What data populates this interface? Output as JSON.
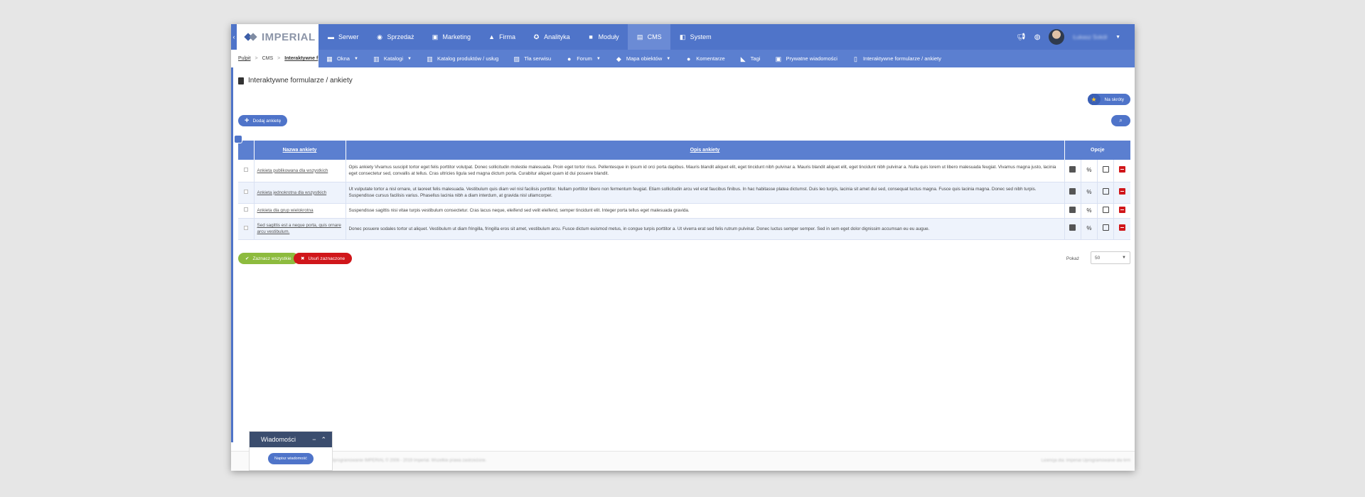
{
  "brand": {
    "name": "IMPERIAL"
  },
  "topnav": {
    "items": [
      {
        "label": "Serwer",
        "icon": "server-icon"
      },
      {
        "label": "Sprzedaż",
        "icon": "sales-icon"
      },
      {
        "label": "Marketing",
        "icon": "marketing-icon"
      },
      {
        "label": "Firma",
        "icon": "company-icon"
      },
      {
        "label": "Analityka",
        "icon": "analytics-icon"
      },
      {
        "label": "Moduły",
        "icon": "modules-icon"
      },
      {
        "label": "CMS",
        "icon": "cms-icon",
        "active": true
      },
      {
        "label": "System",
        "icon": "system-icon"
      }
    ],
    "user": {
      "name": "Łukasz Sokół"
    }
  },
  "breadcrumb": {
    "items": [
      "Pulpit",
      "CMS",
      "Interaktywne f"
    ]
  },
  "subnav": {
    "items": [
      {
        "label": "Okna",
        "dropdown": true
      },
      {
        "label": "Katalogi",
        "dropdown": true
      },
      {
        "label": "Katalog produktów / usług",
        "dropdown": false
      },
      {
        "label": "Tła serwisu",
        "dropdown": false
      },
      {
        "label": "Forum",
        "dropdown": true
      },
      {
        "label": "Mapa obiektów",
        "dropdown": true
      },
      {
        "label": "Komentarze",
        "dropdown": false
      },
      {
        "label": "Tagi",
        "dropdown": false
      },
      {
        "label": "Prywatne wiadomości",
        "dropdown": false
      },
      {
        "label": "Interaktywne formularze / ankiety",
        "dropdown": false
      }
    ]
  },
  "page": {
    "title": "Interaktywne formularze / ankiety"
  },
  "actions": {
    "favorite_label": "Na skróty",
    "add_label": "Dodaj ankietę",
    "check_all_label": "Zaznacz wszystkie",
    "delete_selected_label": "Usuń zaznaczone"
  },
  "table": {
    "headers": {
      "name": "Nazwa ankiety",
      "description": "Opis ankiety",
      "options": "Opcje"
    },
    "rows": [
      {
        "name": "Ankieta publikowana dla wszystkich",
        "description": "Opis ankiety Vivamus suscipit tortor eget felis porttitor volutpat. Donec sollicitudin molestie malesuada. Proin eget tortor risus. Pellentesque in ipsum id orci porta dapibus. Mauris blandit aliquet elit, eget tincidunt nibh pulvinar a. Mauris blandit aliquet elit, eget tincidunt nibh pulvinar a. Nulla quis lorem ut libero malesuada feugiat. Vivamus magna justo, lacinia eget consectetur sed, convallis at tellus. Cras ultricies ligula sed magna dictum porta. Curabitur aliquet quam id dui posuere blandit."
      },
      {
        "name": "Ankieta jednokrotna dla wszystkich",
        "description": "Ut vulputate tortor a nisl ornare, ut laoreet felis malesuada. Vestibulum quis diam vel nisl facilisis porttitor. Nullam porttitor libero non fermentum feugiat. Etiam sollicitudin arcu vel erat faucibus finibus. In hac habitasse platea dictumst. Duis leo turpis, lacinia sit amet dui sed, consequat luctus magna. Fusce quis lacinia magna. Donec sed nibh turpis. Suspendisse cursus facilisis varius. Phasellus lacinia nibh a diam interdum, at gravida nisl ullamcorper."
      },
      {
        "name": "Ankieta dla grup wielokrotna",
        "description": "Suspendisse sagittis nisi vitae turpis vestibulum consectetur. Cras lacus neque, eleifend sed velit eleifend, semper tincidunt elit. Integer porta tellus eget malesuada gravida."
      },
      {
        "name": "Sed sagittis est a neque porta, quis ornare arcu vestibulum.",
        "description": "Donec posuere sodales tortor ut aliquet. Vestibulum ut diam fringilla, fringilla eros sit amet, vestibulum arcu. Fusce dictum euismod metus, in congue turpis porttitor a. Ut viverra erat sed felis rutrum pulvinar. Donec luctus semper semper. Sed in sem eget dolor dignissim accumsan eu eu augue."
      }
    ]
  },
  "pagination": {
    "show_label": "Pokaż",
    "per_page": "50"
  },
  "footer": {
    "left": "Oprogramowanie IMPERIAL © 2006 - 2019 Imperial. Wszelkie prawa zastrzeżone.",
    "right": "Licencja dla: Imperial Oprogramowanie dla firm"
  },
  "messages": {
    "title": "Wiadomości",
    "write_label": "Napisz wiadomość"
  },
  "colors": {
    "primary": "#4f74c9",
    "subnav": "#5b7fd0",
    "success": "#8dbb3e",
    "danger": "#d0161a",
    "widget_header": "#3b4d6e"
  }
}
